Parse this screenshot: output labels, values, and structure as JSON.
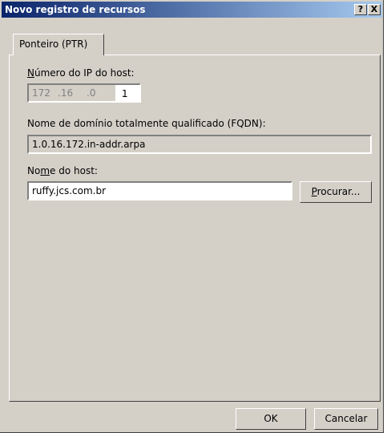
{
  "window": {
    "title": "Novo registro de recursos",
    "help_label": "?",
    "close_label": "X"
  },
  "tabs": [
    {
      "label": "Ponteiro (PTR)"
    }
  ],
  "ip": {
    "label_prefix": "N",
    "label_rest": "úmero do IP do host:",
    "octet1": "172",
    "octet2": ".16",
    "octet3": ".0",
    "octet4_sep": ".",
    "octet4": "1"
  },
  "fqdn": {
    "label": "Nome de domínio totalmente qualificado (FQDN):",
    "value": "1.0.16.172.in-addr.arpa"
  },
  "host": {
    "label_prefix": "No",
    "label_u": "m",
    "label_rest": "e do host:",
    "value": "ruffy.jcs.com.br",
    "browse_label_u": "P",
    "browse_label_rest": "rocurar..."
  },
  "footer": {
    "ok_label": "OK",
    "cancel_label": "Cancelar"
  }
}
